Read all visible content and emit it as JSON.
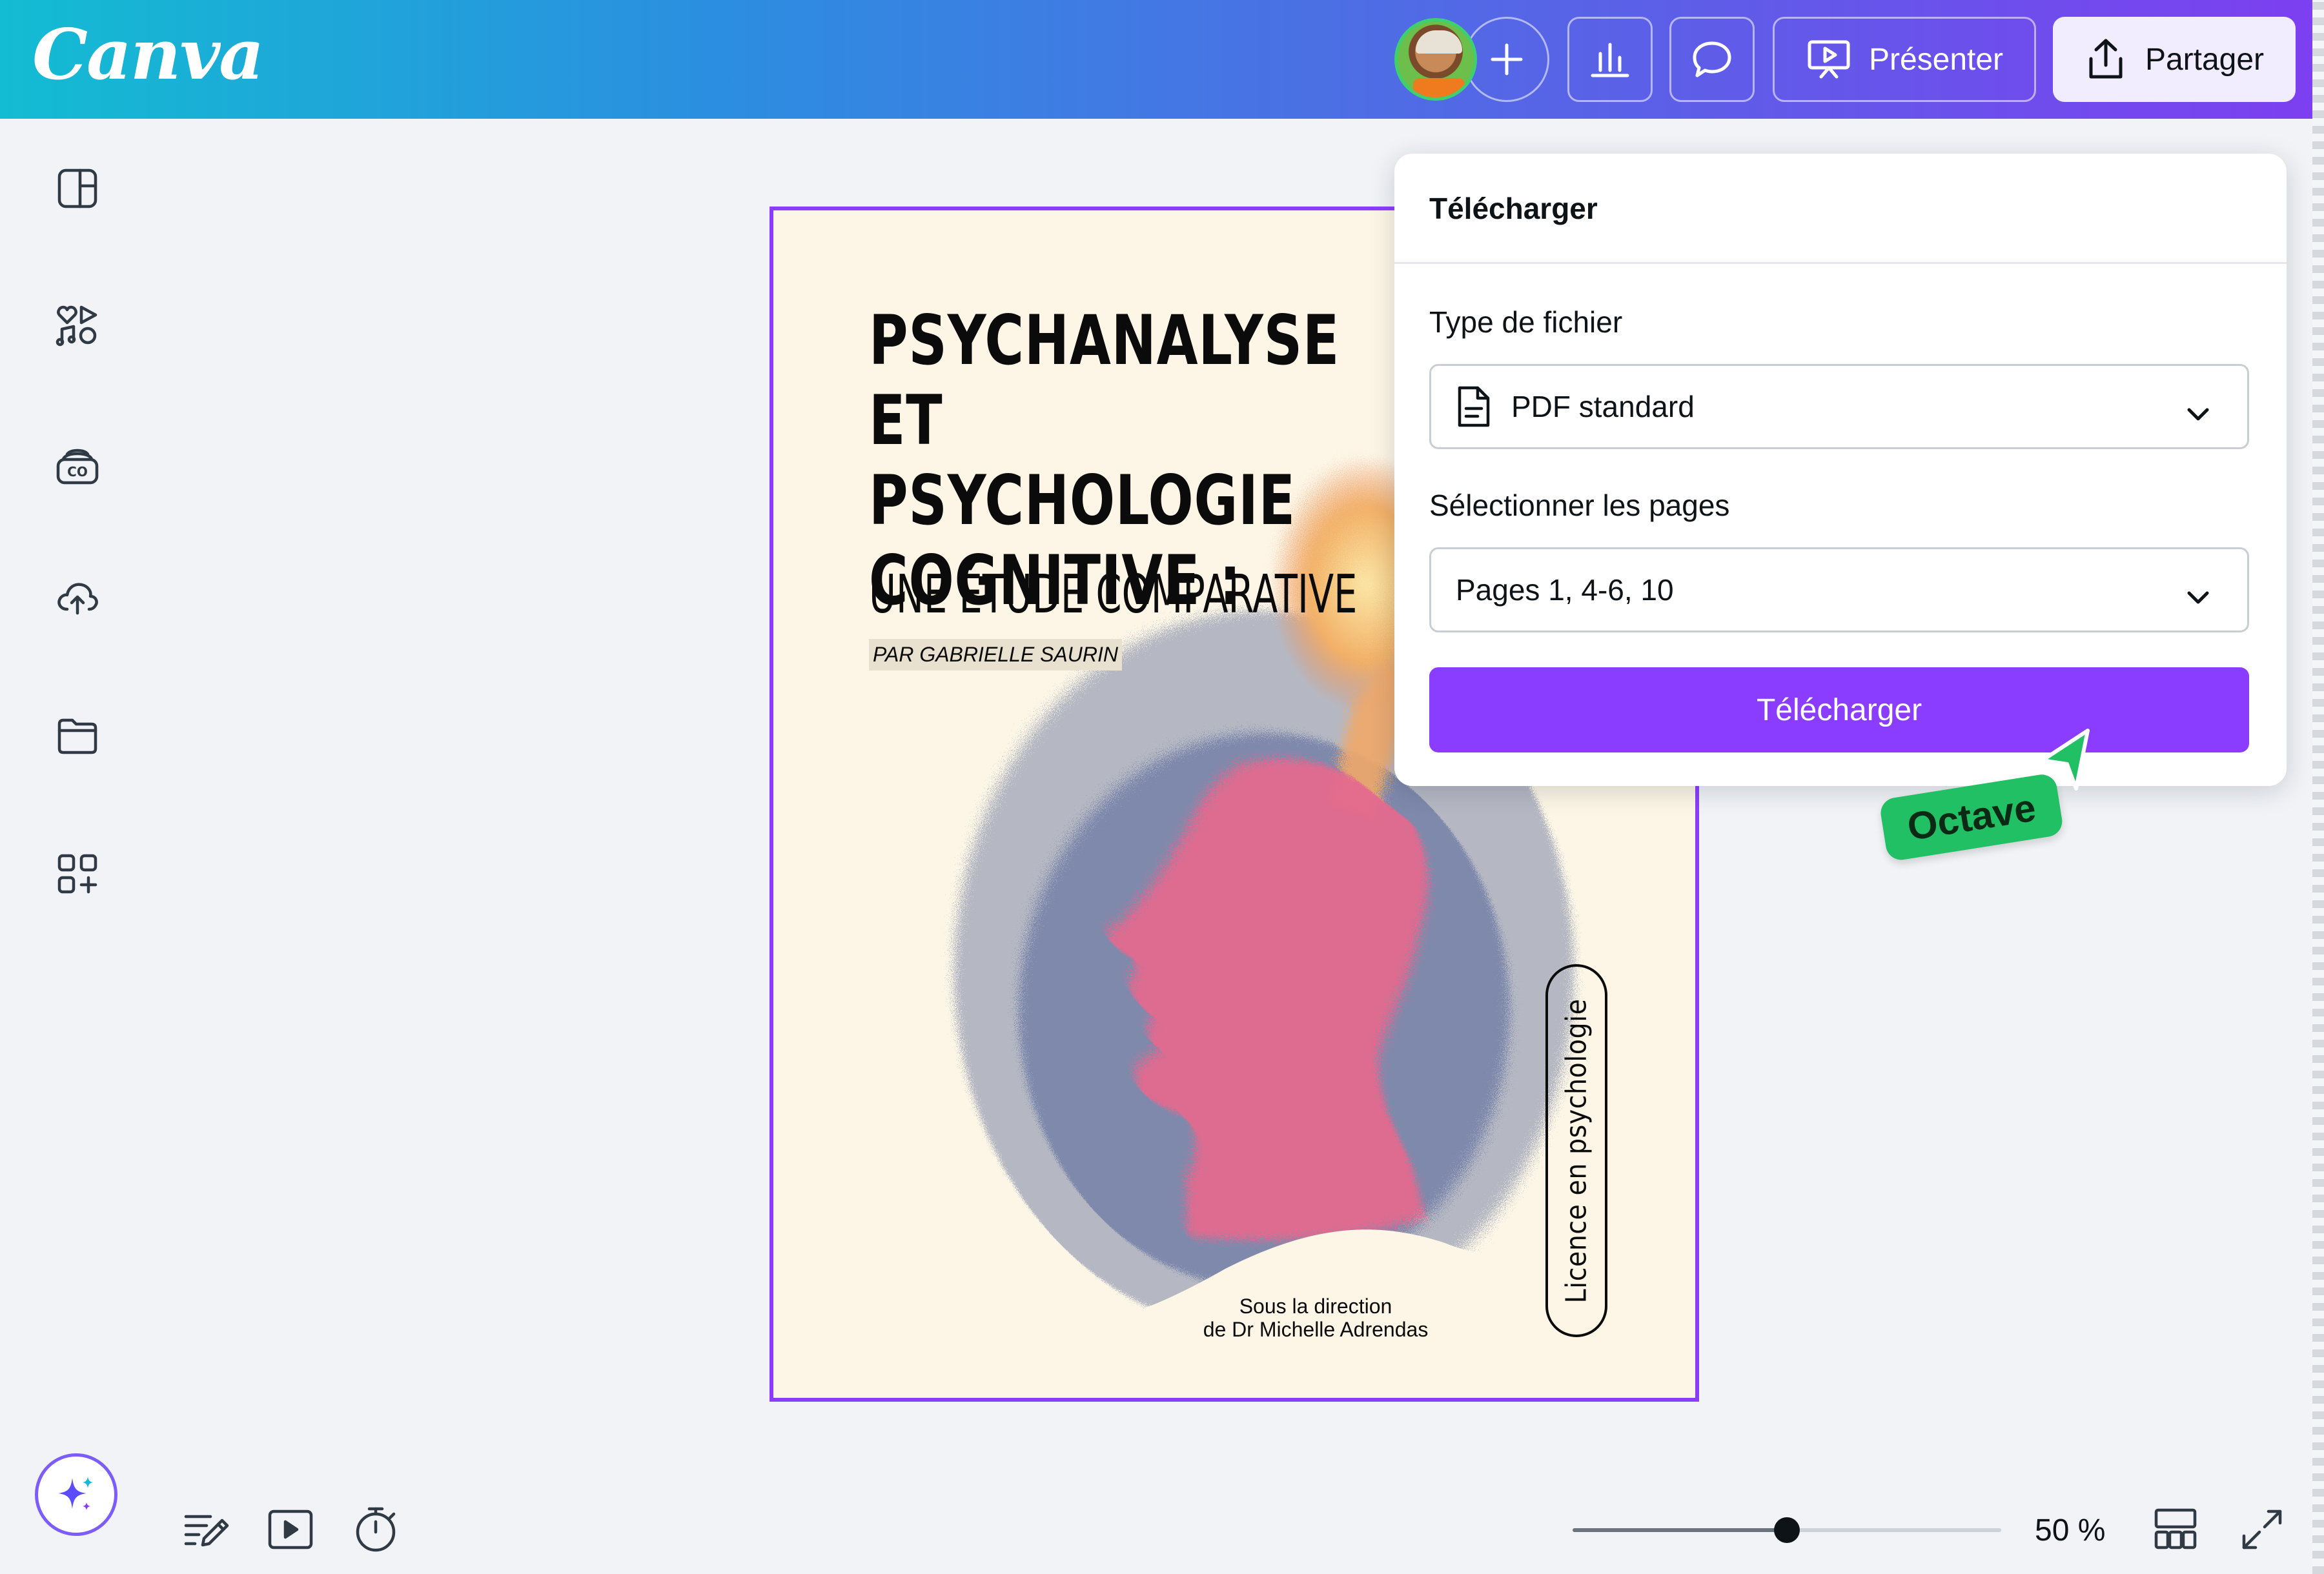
{
  "app": {
    "logo_text": "Canva"
  },
  "header": {
    "add_label": "+",
    "present_label": "Présenter",
    "share_label": "Partager"
  },
  "sidebar": {
    "items": [
      {
        "icon": "layout-icon"
      },
      {
        "icon": "elements-icon"
      },
      {
        "icon": "brand-icon"
      },
      {
        "icon": "upload-icon"
      },
      {
        "icon": "projects-icon"
      },
      {
        "icon": "apps-icon"
      }
    ]
  },
  "design": {
    "title": "PSYCHANALYSE\nET PSYCHOLOGIE\nCOGNITIVE :",
    "subtitle": "UNE ÉTUDE COMPARATIVE",
    "author": "PAR GABRIELLE SAURIN",
    "direction_line1": "Sous la direction",
    "direction_line2": "de Dr Michelle Adrendas",
    "badge": "Licence en psychologie"
  },
  "download_panel": {
    "title": "Télécharger",
    "file_type_label": "Type de fichier",
    "file_type_value": "PDF standard",
    "pages_label": "Sélectionner les pages",
    "pages_value": "Pages 1, 4-6, 10",
    "button_label": "Télécharger"
  },
  "collaborator": {
    "name": "Octave"
  },
  "footer": {
    "zoom_label": "50 %",
    "zoom_fraction": 0.5
  },
  "colors": {
    "accent": "#8b3dff",
    "collaborator": "#22c064",
    "page_background": "#fdf6e6"
  }
}
